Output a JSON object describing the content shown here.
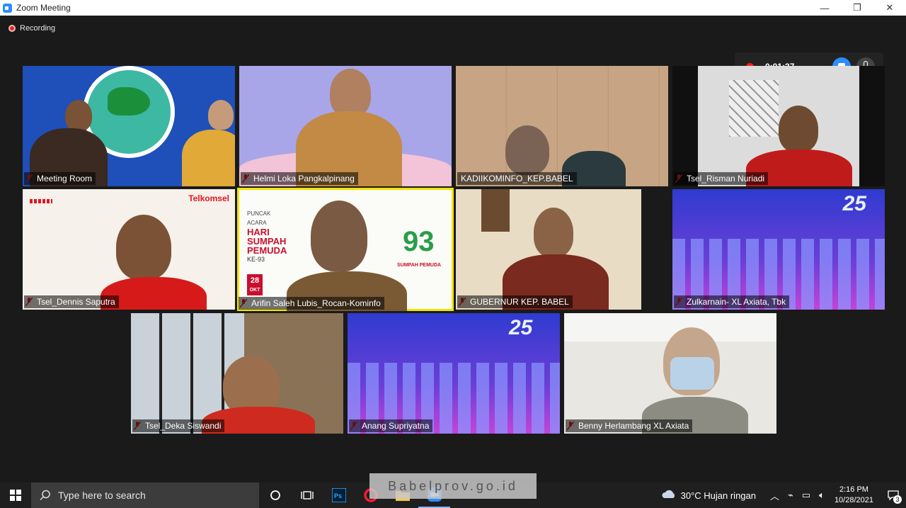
{
  "window": {
    "title": "Zoom Meeting",
    "minimize": "—",
    "maximize": "❐",
    "close": "✕"
  },
  "recording": {
    "label": "Recording",
    "timer": "0:01:37"
  },
  "participants": [
    {
      "name": "Meeting Room"
    },
    {
      "name": "Helmi Loka Pangkalpinang"
    },
    {
      "name": "KADIIKOMINFO_KEP.BABEL"
    },
    {
      "name": "Tsel_Risman Nuriadi"
    },
    {
      "name": "Tsel_Dennis Saputra"
    },
    {
      "name": "Arifin Saleh Lubis_Rocan-Kominfo"
    },
    {
      "name": "GUBERNUR KEP. BABEL"
    },
    {
      "name": "Zulkarnain- XL Axiata, Tbk"
    },
    {
      "name": "Tsel_Deka Siswandi"
    },
    {
      "name": "Anang Supriyatna"
    },
    {
      "name": "Benny Herlambang XL Axiata"
    }
  ],
  "tile_text": {
    "telkomsel": "Telkomsel",
    "puncak": "PUNCAK",
    "acara": "ACARA",
    "hari": "HARI",
    "sumpah": "SUMPAH",
    "pemuda": "PEMUDA",
    "ke": "KE-93",
    "date": "28",
    "month": "OKT",
    "logo_num": "93",
    "logo_caption": "SUMPAH PEMUDA",
    "xl_anniv": "25"
  },
  "taskbar": {
    "search_placeholder": "Type here to search",
    "weather": "30°C  Hujan ringan",
    "time": "2:16 PM",
    "date": "10/28/2021",
    "notifications": "3"
  },
  "watermark": "Babelprov.go.id",
  "colors": {
    "zoom_blue": "#2d8cff",
    "record_red": "#ff1d1d",
    "active_speaker": "#f3e400"
  }
}
